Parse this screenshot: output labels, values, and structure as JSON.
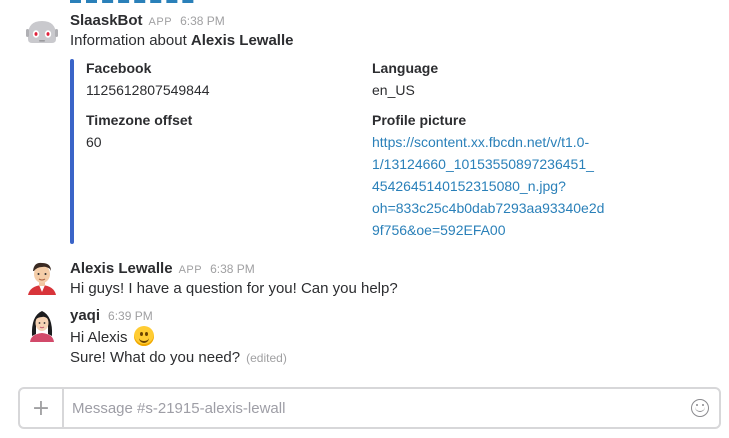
{
  "messages": {
    "bot": {
      "sender": "SlaaskBot",
      "badge": "APP",
      "time": "6:38 PM",
      "text_prefix": "Information about ",
      "text_bold": "Alexis Lewalle",
      "avatar_icon": "robot-icon",
      "attachment": {
        "accent_color": "#3a64c8",
        "fields": {
          "facebook": {
            "title": "Facebook",
            "value": "1125612807549844"
          },
          "language": {
            "title": "Language",
            "value": "en_US"
          },
          "timezone": {
            "title": "Timezone offset",
            "value": "60"
          },
          "profile_picture": {
            "title": "Profile picture",
            "lines": [
              "https://scontent.xx.fbcdn.net/v/t1.0-",
              "1/13124660_10153550897236451_",
              "4542645140152315080_n.jpg?",
              "oh=833c25c4b0dab7293aa93340e2d",
              "9f756&oe=592EFA00"
            ]
          }
        }
      }
    },
    "alexis": {
      "sender": "Alexis Lewalle",
      "badge": "APP",
      "time": "6:38 PM",
      "text": "Hi guys! I have a question for you! Can you help?"
    },
    "yaqi": {
      "sender": "yaqi",
      "time": "6:39 PM",
      "line1": "Hi Alexis",
      "emoji": "slightly-smiling-face",
      "line2": "Sure! What do you need?",
      "edited": "(edited)"
    }
  },
  "composer": {
    "placeholder": "Message #s-21915-alexis-lewall",
    "plus_icon": "plus-icon",
    "emoji_icon": "emoji-picker-icon"
  }
}
